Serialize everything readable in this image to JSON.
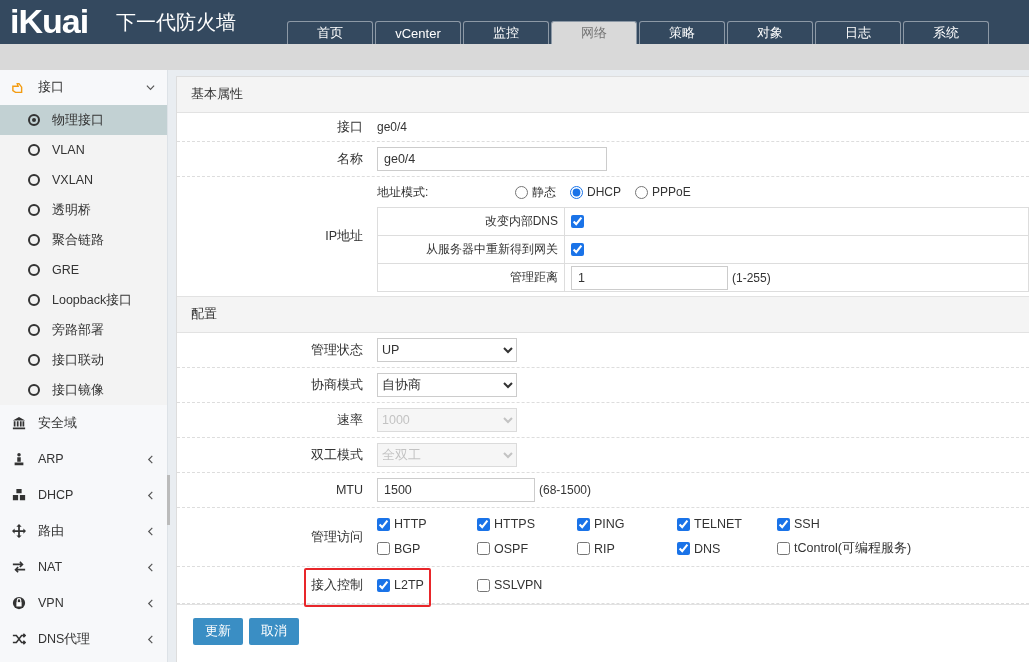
{
  "header": {
    "logo": "iKuai",
    "title": "下一代防火墙"
  },
  "tabs": [
    {
      "label": "首页",
      "selected": false
    },
    {
      "label": "vCenter",
      "selected": false
    },
    {
      "label": "监控",
      "selected": false
    },
    {
      "label": "网络",
      "selected": true
    },
    {
      "label": "策略",
      "selected": false
    },
    {
      "label": "对象",
      "selected": false
    },
    {
      "label": "日志",
      "selected": false
    },
    {
      "label": "系统",
      "selected": false
    }
  ],
  "sidebar": {
    "items": [
      {
        "label": "接口",
        "expanded": true,
        "children": [
          {
            "label": "物理接口",
            "selected": true
          },
          {
            "label": "VLAN",
            "selected": false
          },
          {
            "label": "VXLAN",
            "selected": false
          },
          {
            "label": "透明桥",
            "selected": false
          },
          {
            "label": "聚合链路",
            "selected": false
          },
          {
            "label": "GRE",
            "selected": false
          },
          {
            "label": "Loopback接口",
            "selected": false
          },
          {
            "label": "旁路部署",
            "selected": false
          },
          {
            "label": "接口联动",
            "selected": false
          },
          {
            "label": "接口镜像",
            "selected": false
          }
        ]
      },
      {
        "label": "安全域"
      },
      {
        "label": "ARP",
        "expanded": false
      },
      {
        "label": "DHCP",
        "expanded": false
      },
      {
        "label": "路由",
        "expanded": false
      },
      {
        "label": "NAT",
        "expanded": false
      },
      {
        "label": "VPN",
        "expanded": false
      },
      {
        "label": "DNS代理",
        "expanded": false
      }
    ]
  },
  "basic": {
    "title": "基本属性",
    "interface": {
      "label": "接口",
      "value": "ge0/4"
    },
    "name": {
      "label": "名称",
      "value": "ge0/4"
    },
    "ip": {
      "label": "IP地址",
      "mode_label": "地址模式:",
      "modes": [
        {
          "label": "静态",
          "selected": false
        },
        {
          "label": "DHCP",
          "selected": true
        },
        {
          "label": "PPPoE",
          "selected": false
        }
      ],
      "options": [
        {
          "label": "改变内部DNS",
          "checked": true
        },
        {
          "label": "从服务器中重新得到网关",
          "checked": true
        }
      ],
      "distance": {
        "label": "管理距离",
        "value": "1",
        "hint": "(1-255)"
      }
    }
  },
  "config": {
    "title": "配置",
    "rows": [
      {
        "kind": "select",
        "label": "管理状态",
        "value": "UP",
        "disabled": false
      },
      {
        "kind": "select",
        "label": "协商模式",
        "value": "自协商",
        "disabled": false
      },
      {
        "kind": "select",
        "label": "速率",
        "value": "1000",
        "disabled": true
      },
      {
        "kind": "select",
        "label": "双工模式",
        "value": "全双工",
        "disabled": true
      },
      {
        "kind": "input",
        "label": "MTU",
        "value": "1500",
        "hint": "(68-1500)"
      },
      {
        "kind": "checks",
        "label": "管理访问",
        "options": [
          {
            "label": "HTTP",
            "checked": true
          },
          {
            "label": "HTTPS",
            "checked": true
          },
          {
            "label": "PING",
            "checked": true
          },
          {
            "label": "TELNET",
            "checked": true
          },
          {
            "label": "SSH",
            "checked": true
          },
          {
            "label": "BGP",
            "checked": false
          },
          {
            "label": "OSPF",
            "checked": false
          },
          {
            "label": "RIP",
            "checked": false
          },
          {
            "label": "DNS",
            "checked": true
          },
          {
            "label": "tControl(可编程服务)",
            "checked": false
          }
        ]
      },
      {
        "kind": "checks",
        "label": "接入控制",
        "highlighted": true,
        "options": [
          {
            "label": "L2TP",
            "checked": true
          },
          {
            "label": "SSLVPN",
            "checked": false
          }
        ]
      }
    ]
  },
  "buttons": [
    "更新",
    "取消"
  ]
}
